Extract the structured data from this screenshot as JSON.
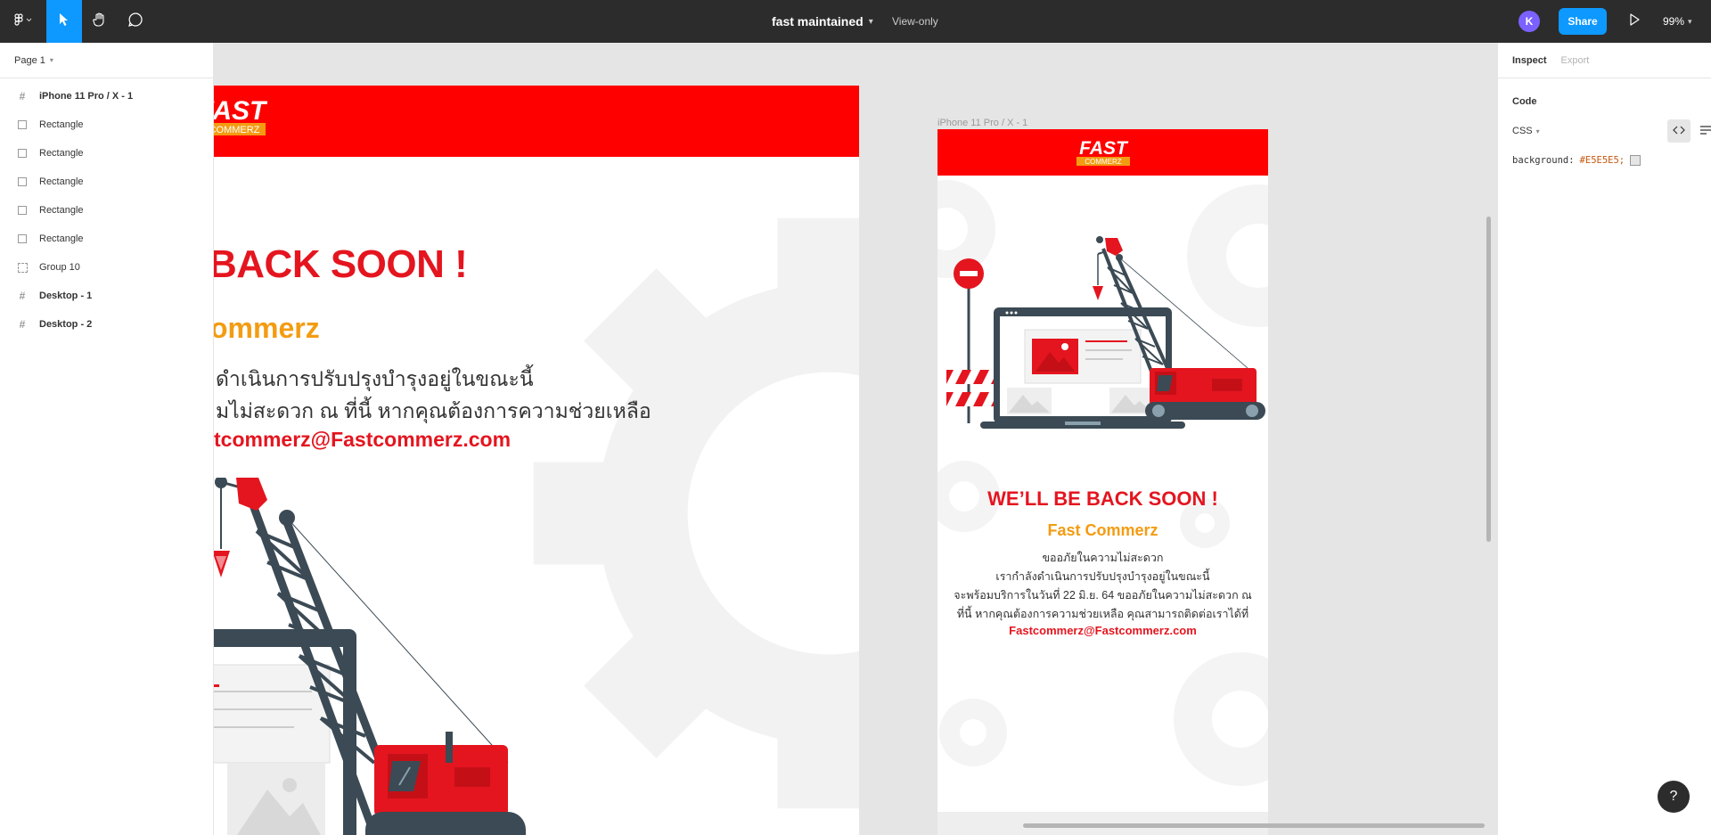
{
  "toolbar": {
    "file_title": "fast maintained",
    "view_mode": "View-only",
    "avatar_initial": "K",
    "share_label": "Share",
    "zoom": "99%"
  },
  "left_panel": {
    "page_name": "Page 1",
    "layers": [
      {
        "label": "iPhone 11 Pro / X - 1",
        "kind": "frame"
      },
      {
        "label": "Rectangle",
        "kind": "rectangle"
      },
      {
        "label": "Rectangle",
        "kind": "rectangle"
      },
      {
        "label": "Rectangle",
        "kind": "rectangle"
      },
      {
        "label": "Rectangle",
        "kind": "rectangle"
      },
      {
        "label": "Rectangle",
        "kind": "rectangle"
      },
      {
        "label": "Group 10",
        "kind": "group"
      },
      {
        "label": "Desktop - 1",
        "kind": "frame"
      },
      {
        "label": "Desktop - 2",
        "kind": "frame"
      }
    ]
  },
  "canvas": {
    "desktop": {
      "logo_text": "FAST",
      "logo_sub": "COMMERZ",
      "title_visible": "BACK SOON !",
      "brand_visible": "ommerz",
      "line1_visible": "ดำเนินการปรับปรุงบำรุงอยู่ในขณะนี้",
      "line2_visible": "มไม่สะดวก ณ ที่นี้ หากคุณต้องการความช่วยเหลือ",
      "email_visible": "tcommerz@Fastcommerz.com"
    },
    "mobile": {
      "frame_label": "iPhone 11 Pro / X - 1",
      "logo_text": "FAST",
      "logo_sub": "COMMERZ",
      "title": "WE’LL BE BACK SOON !",
      "brand": "Fast Commerz",
      "line1": "ขออภัยในความไม่สะดวก",
      "line2": "เรากำลังดำเนินการปรับปรุงบำรุงอยู่ในขณะนี้",
      "line3": "จะพร้อมบริการในวันที่ 22 มิ.ย. 64 ขออภัยในความไม่สะดวก ณ",
      "line4": "ที่นี้ หากคุณต้องการความช่วยเหลือ คุณสามารถติดต่อเราได้ที่",
      "email": "Fastcommerz@Fastcommerz.com"
    }
  },
  "right_panel": {
    "tabs": [
      "Inspect",
      "Export"
    ],
    "section_label": "Code",
    "language": "CSS",
    "property": "background:",
    "value": "#E5E5E5;"
  },
  "colors": {
    "toolbar_bg": "#2c2c2c",
    "accent_blue": "#0d99ff",
    "header_red": "#ff0000",
    "title_red": "#e4151f",
    "brand_orange": "#f39c12",
    "canvas_bg": "#e5e5e5",
    "avatar_purple": "#7b61ff"
  },
  "icons": [
    "figma-menu-icon",
    "move-tool-icon",
    "hand-tool-icon",
    "comment-tool-icon",
    "play-icon",
    "frame-icon",
    "rectangle-icon",
    "group-icon",
    "code-view-icon",
    "list-view-icon",
    "help-icon"
  ]
}
